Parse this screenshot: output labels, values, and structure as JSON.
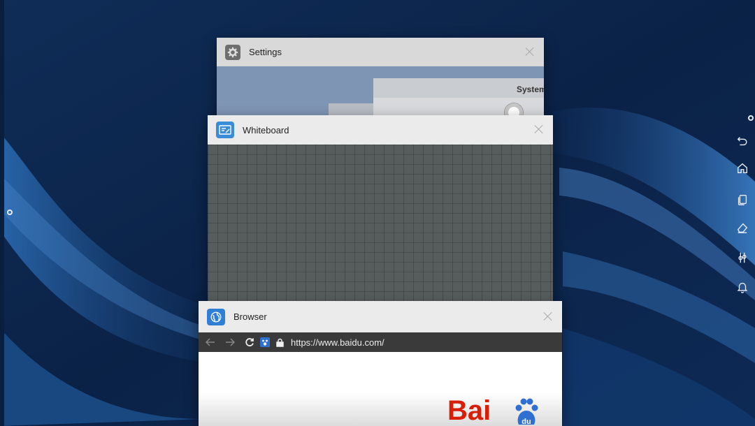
{
  "background": {
    "wallpaper_color": "#0e2a52",
    "accent_color": "#2a69b0"
  },
  "left_handle": {
    "icon": "circle-handle-icon"
  },
  "nav_bar": {
    "items": [
      {
        "name": "back",
        "icon": "back-arrow-icon"
      },
      {
        "name": "home",
        "icon": "home-icon"
      },
      {
        "name": "recents",
        "icon": "recent-apps-icon"
      },
      {
        "name": "annotate",
        "icon": "eraser-icon"
      },
      {
        "name": "settings",
        "icon": "sliders-icon"
      },
      {
        "name": "notifications",
        "icon": "bell-icon"
      }
    ]
  },
  "cards": {
    "settings": {
      "title": "Settings",
      "icon": "gear-icon",
      "content_heading": "System"
    },
    "whiteboard": {
      "title": "Whiteboard",
      "icon": "whiteboard-icon"
    },
    "browser": {
      "title": "Browser",
      "icon": "globe-icon",
      "url": "https://www.baidu.com/",
      "logo_text": "Bai",
      "brand_color": "#d81e06"
    }
  }
}
